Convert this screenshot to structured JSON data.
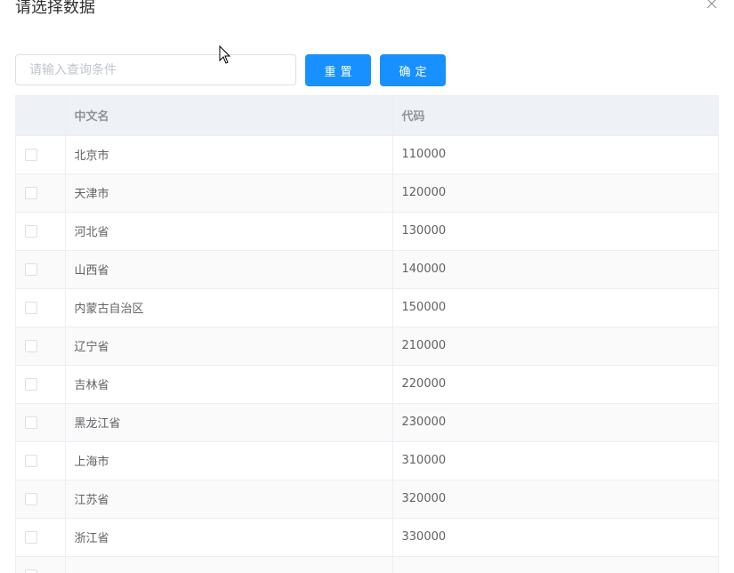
{
  "dialog": {
    "title": "请选择数据",
    "close_icon": "close-icon"
  },
  "search": {
    "placeholder": "请输入查询条件",
    "value": ""
  },
  "buttons": {
    "reset_label": "重置",
    "confirm_label": "确定"
  },
  "colors": {
    "primary": "#1890ff",
    "header_bg": "#eef1f6",
    "border": "#ebeef5",
    "stripe": "#fafafa"
  },
  "table": {
    "columns": [
      "中文名",
      "代码"
    ],
    "rows": [
      {
        "name": "北京市",
        "code": "110000"
      },
      {
        "name": "天津市",
        "code": "120000"
      },
      {
        "name": "河北省",
        "code": "130000"
      },
      {
        "name": "山西省",
        "code": "140000"
      },
      {
        "name": "内蒙古自治区",
        "code": "150000"
      },
      {
        "name": "辽宁省",
        "code": "210000"
      },
      {
        "name": "吉林省",
        "code": "220000"
      },
      {
        "name": "黑龙江省",
        "code": "230000"
      },
      {
        "name": "上海市",
        "code": "310000"
      },
      {
        "name": "江苏省",
        "code": "320000"
      },
      {
        "name": "浙江省",
        "code": "330000"
      },
      {
        "name": "",
        "code": ""
      }
    ]
  }
}
